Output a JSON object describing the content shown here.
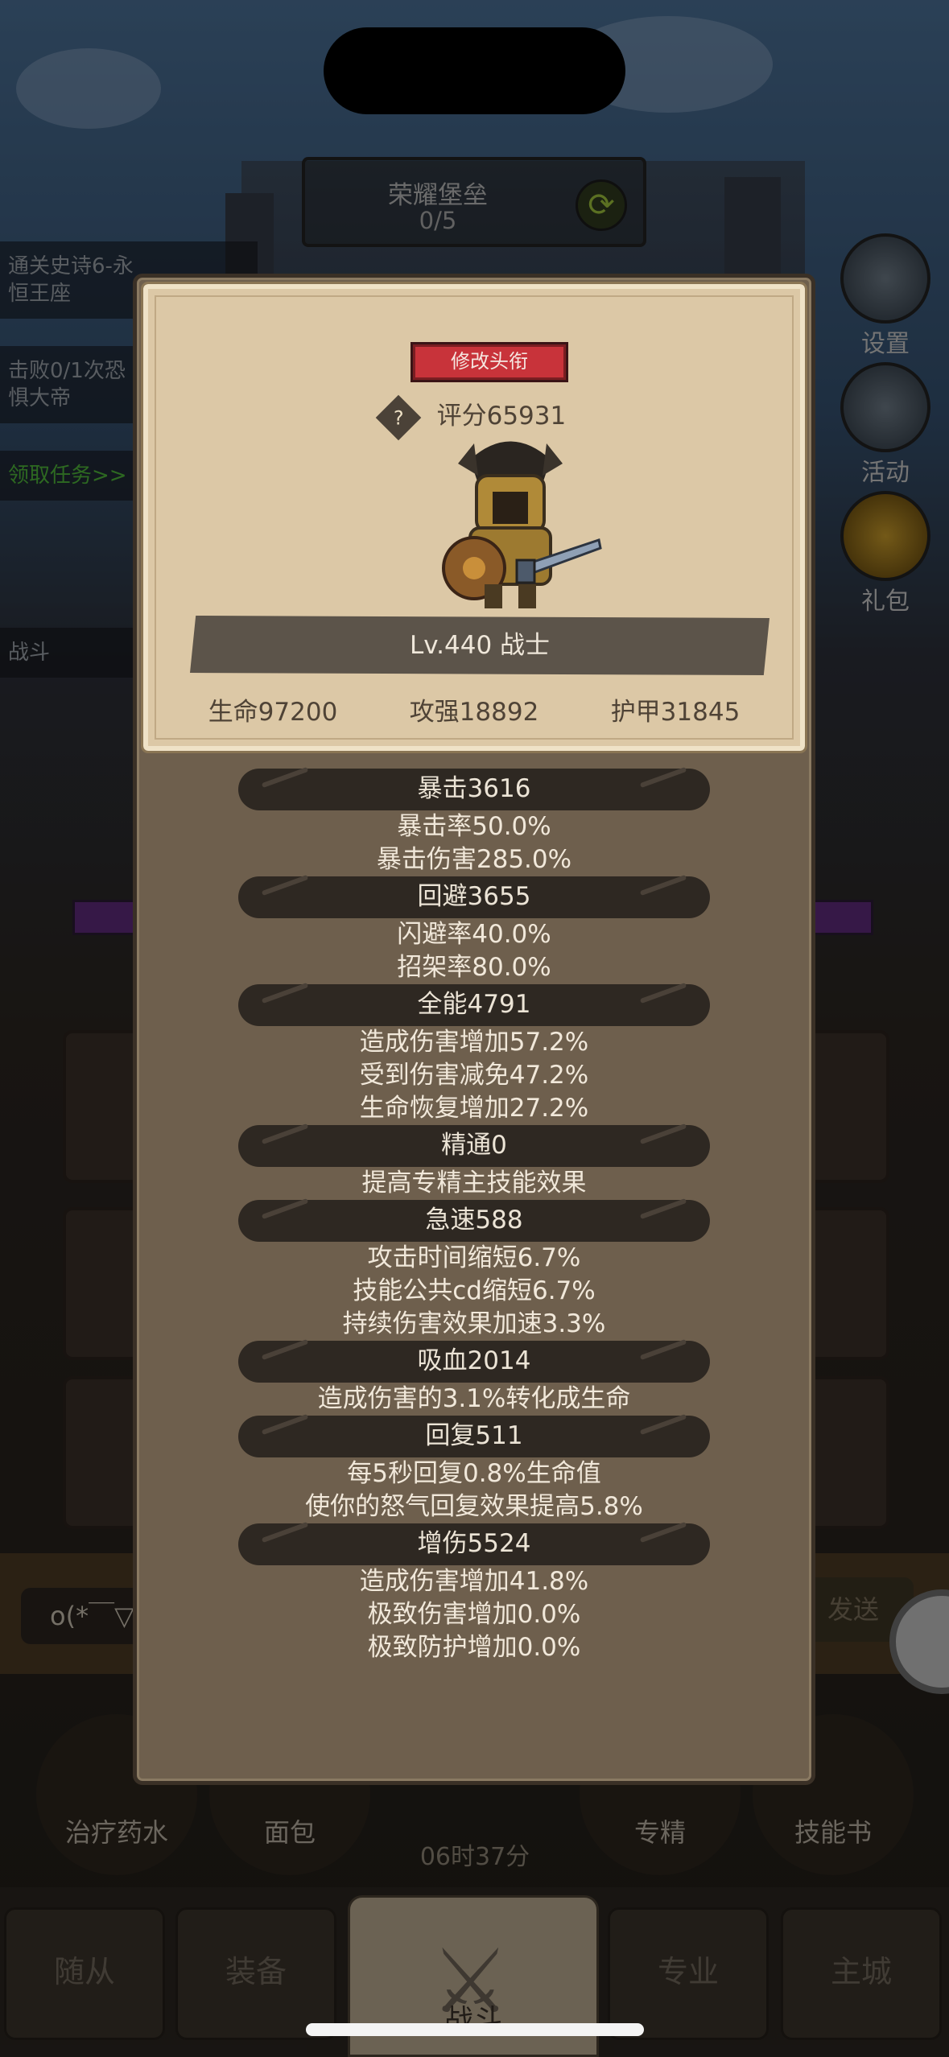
{
  "background": {
    "fortress": {
      "title": "荣耀堡垒",
      "progress": "0/5"
    },
    "quests": [
      {
        "line1": "通关史诗6-永",
        "line2": "恒王座"
      },
      {
        "line1": "击败0/1次恐",
        "line2": "惧大帝"
      }
    ],
    "claim_quest": "领取任务>>",
    "side_buttons": [
      "设置",
      "活动",
      "礼包"
    ],
    "battle_label": "战斗",
    "chat_input": "o(*￣▽",
    "send_label": "发送",
    "items": [
      "治疗药水",
      "面包",
      "专精",
      "技能书"
    ],
    "timer": "06时37分",
    "nav": {
      "left1": "随从",
      "left2": "装备",
      "center": "战斗",
      "right1": "专业",
      "right2": "主城"
    }
  },
  "modal": {
    "rename_button": "修改头衔",
    "score": "评分65931",
    "level_class": "Lv.440 战士",
    "base_stats": {
      "hp": "生命97200",
      "atk": "攻强18892",
      "armor": "护甲31845"
    },
    "groups": [
      {
        "header": "暴击3616",
        "lines": [
          "暴击率50.0%",
          "暴击伤害285.0%"
        ]
      },
      {
        "header": "回避3655",
        "lines": [
          "闪避率40.0%",
          "招架率80.0%"
        ]
      },
      {
        "header": "全能4791",
        "lines": [
          "造成伤害增加57.2%",
          "受到伤害减免47.2%",
          "生命恢复增加27.2%"
        ]
      },
      {
        "header": "精通0",
        "lines": [
          "提高专精主技能效果"
        ]
      },
      {
        "header": "急速588",
        "lines": [
          "攻击时间缩短6.7%",
          "技能公共cd缩短6.7%",
          "持续伤害效果加速3.3%"
        ]
      },
      {
        "header": "吸血2014",
        "lines": [
          "造成伤害的3.1%转化成生命"
        ]
      },
      {
        "header": "回复511",
        "lines": [
          "每5秒回复0.8%生命值",
          "使你的怒气回复效果提高5.8%"
        ]
      },
      {
        "header": "增伤5524",
        "lines": [
          "造成伤害增加41.8%",
          "极致伤害增加0.0%",
          "极致防护增加0.0%"
        ]
      }
    ]
  },
  "colors": {
    "panel": "#6e5f4d",
    "card": "#dcc8a6",
    "header_pill": "#2e2822",
    "rename": "#c8333a"
  }
}
